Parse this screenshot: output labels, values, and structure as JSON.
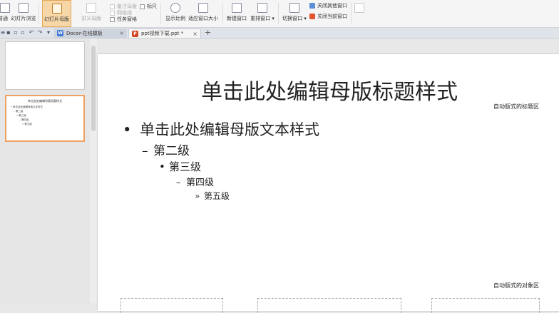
{
  "ribbon": {
    "normal_label": "普通",
    "slide_sorter_label": "幻灯片浏览",
    "master_label": "幻灯片母版",
    "handout_master_label": "讲义母版",
    "notes_master_label": "备注母版",
    "ruler_label": "标尺",
    "grid_label": "网格线",
    "task_pane_label": "任务窗格",
    "zoom_label": "显示比例",
    "fit_window_label": "适应窗口大小",
    "new_window_label": "新建窗口",
    "arrange_label": "重排窗口",
    "switch_window_label": "切换窗口",
    "close_other_label": "关闭其他窗口",
    "close_current_label": "关闭当前窗口"
  },
  "tabs": [
    {
      "label": "Docer-在线模板",
      "icon": "docer-icon",
      "color": "#3d7ad6"
    },
    {
      "label": "ppt视频下载.ppt *",
      "icon": "ppt-file-icon",
      "color": "#d24726"
    }
  ],
  "thumbnails": {
    "master_title": "单击此处编辑母版标题样式",
    "lines": [
      "• 单击此处编辑母版文本样式",
      "– 第二级",
      "• 第三级",
      "– 第四级",
      "» 第五级"
    ]
  },
  "slide": {
    "title": "单击此处编辑母版标题样式",
    "title_area_note": "自动版式的标题区",
    "object_area_note": "自动版式的对象区",
    "bullets": [
      {
        "marker": "•",
        "text": "单击此处编辑母版文本样式"
      },
      {
        "marker": "–",
        "text": "第二级"
      },
      {
        "marker": "•",
        "text": "第三级"
      },
      {
        "marker": "–",
        "text": "第四级"
      },
      {
        "marker": "»",
        "text": "第五级"
      }
    ]
  },
  "colors": {
    "accent": "#f7d7a8",
    "selection": "#f0a060"
  }
}
